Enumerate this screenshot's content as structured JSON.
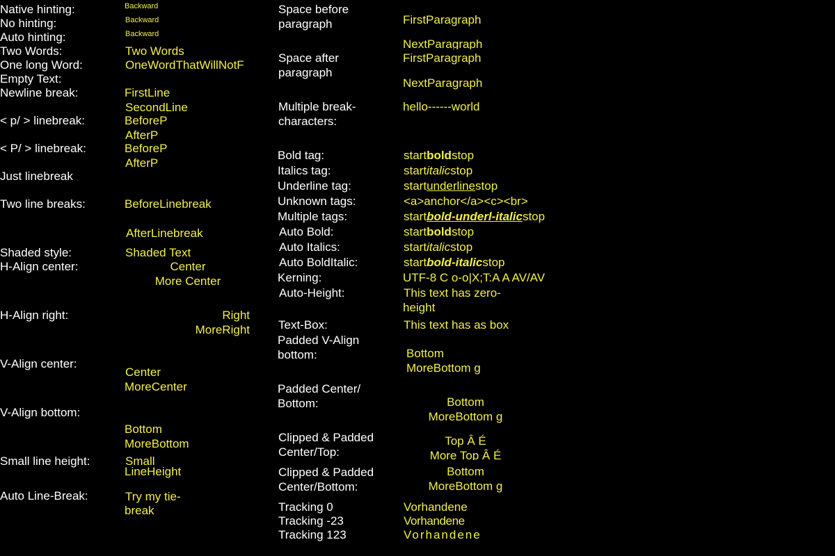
{
  "colors": {
    "background": "#000000",
    "label": "#ffffff",
    "value": "#f2ef4a"
  },
  "left": {
    "native_hinting": {
      "label": "Native hinting:",
      "value": "Backward"
    },
    "no_hinting": {
      "label": "No hinting:",
      "value": "Backward"
    },
    "auto_hinting": {
      "label": "Auto hinting:",
      "value": "Backward"
    },
    "two_words": {
      "label": "Two Words:",
      "value": "Two Words"
    },
    "long_word": {
      "label": "One long Word:",
      "value": "OneWordThatWillNotF"
    },
    "empty_text": {
      "label": "Empty Text:"
    },
    "newline_break": {
      "label": "Newline break:",
      "line1": "FirstLine",
      "line2": "SecondLine"
    },
    "p_linebreak": {
      "label": "< p/ > linebreak:",
      "line1": "BeforeP",
      "line2": "AfterP"
    },
    "P_linebreak": {
      "label": "< P/ > linebreak:",
      "line1": "BeforeP",
      "line2": "AfterP"
    },
    "just_linebreak": {
      "label": "Just linebreak"
    },
    "two_line_breaks": {
      "label": "Two line breaks:",
      "line1": "BeforeLinebreak",
      "line2": "AfterLinebreak"
    },
    "shaded_style": {
      "label": "Shaded style:",
      "value": "Shaded Text"
    },
    "halign_center": {
      "label": "H-Align center:",
      "line1": "Center",
      "line2": "More Center"
    },
    "halign_right": {
      "label": "H-Align right:",
      "line1": "Right",
      "line2": "MoreRight"
    },
    "valign_center": {
      "label": "V-Align center:",
      "line1": "Center",
      "line2": "MoreCenter"
    },
    "valign_bottom": {
      "label": "V-Align bottom:",
      "line1": "Bottom",
      "line2": "MoreBottom"
    },
    "small_line_height": {
      "label": "Small line height:",
      "line1": "Small",
      "line2": "LineHeight"
    },
    "auto_line_break": {
      "label": "Auto Line-Break:",
      "line1": "Try my tie-",
      "line2": "break"
    }
  },
  "right": {
    "space_before": {
      "label1": "Space before",
      "label2": "paragraph",
      "line1": "FirstParagraph",
      "line2": "NextParagraph"
    },
    "space_after": {
      "label1": "Space after",
      "label2": "paragraph",
      "line1": "FirstParagraph",
      "line2": "NextParagraph"
    },
    "multiple_break": {
      "label1": "Multiple break-",
      "label2": "characters:",
      "value": "hello------world"
    },
    "bold_tag": {
      "label": "Bold tag:",
      "pre": "start",
      "mid": "bold",
      "post": "stop"
    },
    "italics_tag": {
      "label": "Italics tag:",
      "pre": "start",
      "mid": "italic",
      "post": "stop"
    },
    "underline_tag": {
      "label": "Underline tag:",
      "pre": "start",
      "mid": "underline",
      "post": "stop"
    },
    "unknown_tags": {
      "label": "Unknown tags:",
      "value": "<a>anchor</a><c><br>"
    },
    "multiple_tags": {
      "label": "Multiple tags:",
      "pre": "start",
      "mid": "bold-underl-italic",
      "post": "stop"
    },
    "auto_bold": {
      "label": "Auto Bold:",
      "pre": "start",
      "mid": "bold",
      "post": "stop"
    },
    "auto_italics": {
      "label": "Auto Italics:",
      "pre": "start",
      "mid": "italic",
      "post": "stop"
    },
    "auto_bolditalic": {
      "label": "Auto BoldItalic:",
      "pre": "start",
      "mid": "bold-italic",
      "post": "stop"
    },
    "kerning": {
      "label": "Kerning:",
      "value": "UTF-8 C o-o|X;T:A A AV/AV"
    },
    "auto_height": {
      "label": "Auto-Height:",
      "line1": "This text has zero-",
      "line2": "height"
    },
    "text_box": {
      "label": "Text-Box:",
      "value": "This text has  as box"
    },
    "padded_valign_bottom": {
      "label1": "Padded V-Align",
      "label2": "bottom:",
      "line1": "Bottom",
      "line2": "MoreBottom g"
    },
    "padded_center_bottom": {
      "label1": "Padded Center/",
      "label2": "Bottom:",
      "line1": "Bottom",
      "line2": "MoreBottom g"
    },
    "clipped_center_top": {
      "label1": "Clipped & Padded",
      "label2": "Center/Top:",
      "line1": "Top Â É",
      "line2": "More Top Â É"
    },
    "clipped_center_bottom": {
      "label1": "Clipped & Padded",
      "label2": "Center/Bottom:",
      "line1": "Bottom",
      "line2": "MoreBottom g"
    },
    "tracking_0": {
      "label": "Tracking 0",
      "value": "Vorhandene"
    },
    "tracking_m23": {
      "label": "Tracking -23",
      "value": "Vorhandene"
    },
    "tracking_123": {
      "label": "Tracking 123",
      "value": "Vorhandene"
    }
  }
}
